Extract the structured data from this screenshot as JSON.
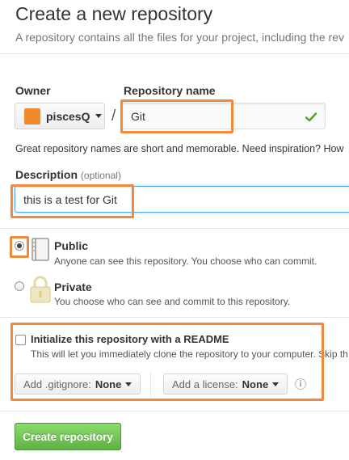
{
  "header": {
    "title": "Create a new repository",
    "subtitle": "A repository contains all the files for your project, including the rev"
  },
  "owner": {
    "label": "Owner",
    "value": "piscesQ",
    "avatar_color": "#f08a2a"
  },
  "separator": "/",
  "repo_name": {
    "label": "Repository name",
    "value": "Git",
    "valid_icon": "check-icon"
  },
  "name_hint": "Great repository names are short and memorable. Need inspiration? How",
  "description": {
    "label": "Description",
    "optional": "(optional)",
    "value": "this is a test for Git"
  },
  "visibility": {
    "public": {
      "title": "Public",
      "desc": "Anyone can see this repository. You choose who can commit.",
      "selected": true,
      "icon": "book-icon"
    },
    "private": {
      "title": "Private",
      "desc": "You choose who can see and commit to this repository.",
      "selected": false,
      "icon": "lock-icon"
    }
  },
  "init": {
    "title": "Initialize this repository with a README",
    "desc": "This will let you immediately clone the repository to your computer. Skip th",
    "checked": false
  },
  "gitignore": {
    "prefix": "Add .gitignore:",
    "value": "None"
  },
  "license": {
    "prefix": "Add a license:",
    "value": "None"
  },
  "submit_label": "Create repository",
  "colors": {
    "highlight": "#f0883e",
    "submit": "#60b044",
    "check": "#55a532"
  }
}
